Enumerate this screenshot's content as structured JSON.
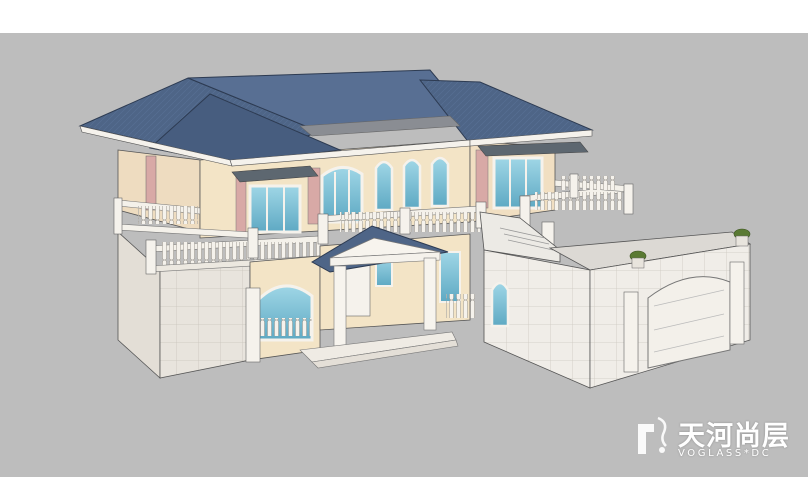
{
  "watermark": {
    "title": "天河尚层",
    "subtitle": "VOGLASS*DC"
  },
  "colors": {
    "background_top": "#ffffff",
    "ground": "#bdbdbd",
    "roof": "#4e6587",
    "wall_cream": "#f3e4c6",
    "wall_pink": "#d8a9a6",
    "stone_base": "#e7e3dc",
    "glass": "#7dc3d9",
    "balustrade": "#f4f1ea"
  }
}
